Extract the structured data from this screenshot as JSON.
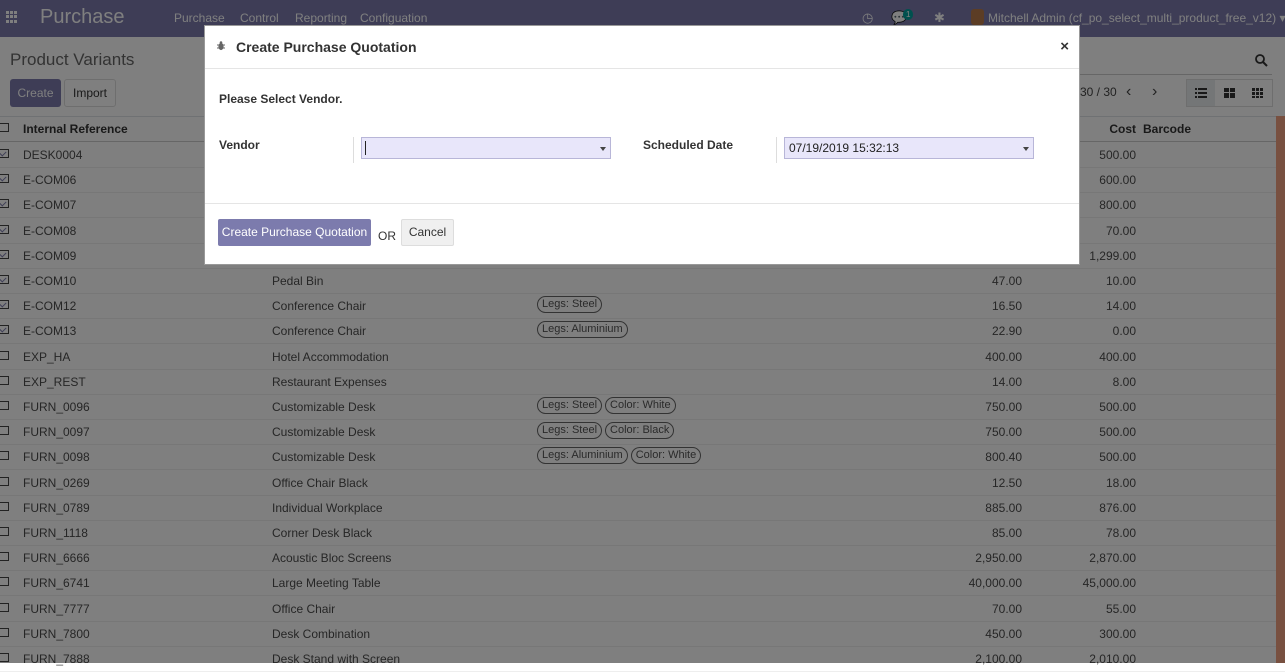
{
  "navbar": {
    "app_title": "Purchase",
    "menu": [
      "Purchase",
      "Control",
      "Reporting",
      "Configuation"
    ],
    "message_count": "1",
    "user_name": "Mitchell Admin (cf_po_select_multi_product_free_v12)"
  },
  "control_panel": {
    "title": "Product Variants",
    "create_label": "Create",
    "import_label": "Import",
    "pager": "30 / 30"
  },
  "table": {
    "headers": {
      "ref": "Internal Reference",
      "cost": "Cost",
      "barcode": "Barcode"
    },
    "rows": [
      {
        "checked": true,
        "ref": "DESK0004",
        "name": "",
        "attrs": [],
        "price": "",
        "cost": "500.00"
      },
      {
        "checked": true,
        "ref": "E-COM06",
        "name": "",
        "attrs": [],
        "price": "",
        "cost": "600.00"
      },
      {
        "checked": true,
        "ref": "E-COM07",
        "name": "",
        "attrs": [],
        "price": "",
        "cost": "800.00"
      },
      {
        "checked": true,
        "ref": "E-COM08",
        "name": "",
        "attrs": [],
        "price": "",
        "cost": "70.00"
      },
      {
        "checked": true,
        "ref": "E-COM09",
        "name": "",
        "attrs": [],
        "price": "",
        "cost": "1,299.00"
      },
      {
        "checked": true,
        "ref": "E-COM10",
        "name": "Pedal Bin",
        "attrs": [],
        "price": "47.00",
        "cost": "10.00"
      },
      {
        "checked": true,
        "ref": "E-COM12",
        "name": "Conference Chair",
        "attrs": [
          "Legs: Steel"
        ],
        "price": "16.50",
        "cost": "14.00"
      },
      {
        "checked": true,
        "ref": "E-COM13",
        "name": "Conference Chair",
        "attrs": [
          "Legs: Aluminium"
        ],
        "price": "22.90",
        "cost": "0.00"
      },
      {
        "checked": false,
        "ref": "EXP_HA",
        "name": "Hotel Accommodation",
        "attrs": [],
        "price": "400.00",
        "cost": "400.00"
      },
      {
        "checked": false,
        "ref": "EXP_REST",
        "name": "Restaurant Expenses",
        "attrs": [],
        "price": "14.00",
        "cost": "8.00"
      },
      {
        "checked": false,
        "ref": "FURN_0096",
        "name": "Customizable Desk",
        "attrs": [
          "Legs: Steel",
          "Color: White"
        ],
        "price": "750.00",
        "cost": "500.00"
      },
      {
        "checked": false,
        "ref": "FURN_0097",
        "name": "Customizable Desk",
        "attrs": [
          "Legs: Steel",
          "Color: Black"
        ],
        "price": "750.00",
        "cost": "500.00"
      },
      {
        "checked": false,
        "ref": "FURN_0098",
        "name": "Customizable Desk",
        "attrs": [
          "Legs: Aluminium",
          "Color: White"
        ],
        "price": "800.40",
        "cost": "500.00"
      },
      {
        "checked": false,
        "ref": "FURN_0269",
        "name": "Office Chair Black",
        "attrs": [],
        "price": "12.50",
        "cost": "18.00"
      },
      {
        "checked": false,
        "ref": "FURN_0789",
        "name": "Individual Workplace",
        "attrs": [],
        "price": "885.00",
        "cost": "876.00"
      },
      {
        "checked": false,
        "ref": "FURN_1118",
        "name": "Corner Desk Black",
        "attrs": [],
        "price": "85.00",
        "cost": "78.00"
      },
      {
        "checked": false,
        "ref": "FURN_6666",
        "name": "Acoustic Bloc Screens",
        "attrs": [],
        "price": "2,950.00",
        "cost": "2,870.00"
      },
      {
        "checked": false,
        "ref": "FURN_6741",
        "name": "Large Meeting Table",
        "attrs": [],
        "price": "40,000.00",
        "cost": "45,000.00"
      },
      {
        "checked": false,
        "ref": "FURN_7777",
        "name": "Office Chair",
        "attrs": [],
        "price": "70.00",
        "cost": "55.00"
      },
      {
        "checked": false,
        "ref": "FURN_7800",
        "name": "Desk Combination",
        "attrs": [],
        "price": "450.00",
        "cost": "300.00"
      },
      {
        "checked": false,
        "ref": "FURN_7888",
        "name": "Desk Stand with Screen",
        "attrs": [],
        "price": "2,100.00",
        "cost": "2,010.00"
      }
    ]
  },
  "modal": {
    "title": "Create Purchase Quotation",
    "close": "×",
    "subtitle": "Please Select Vendor.",
    "vendor_label": "Vendor",
    "vendor_value": "",
    "date_label": "Scheduled Date",
    "date_value": "07/19/2019 15:32:13",
    "primary_button": "Create Purchase Quotation",
    "or_text": "OR",
    "cancel_button": "Cancel"
  }
}
